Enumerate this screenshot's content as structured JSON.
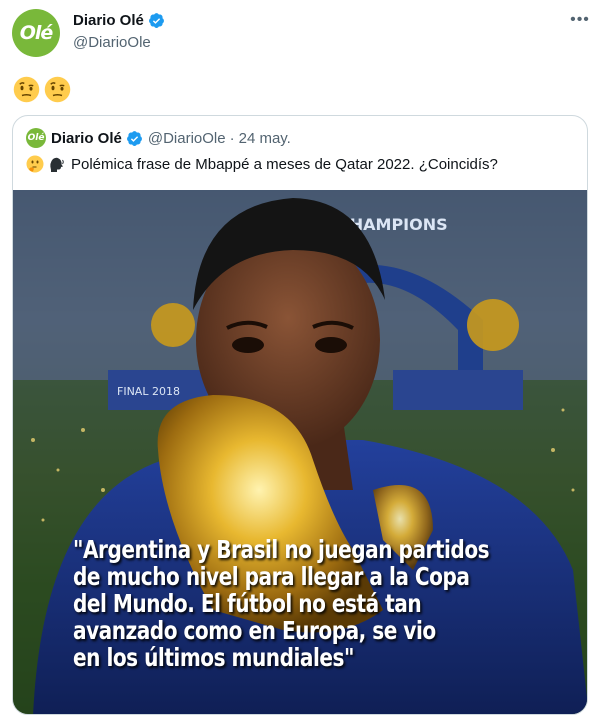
{
  "tweet": {
    "avatar_text": "Olé",
    "display_name": "Diario Olé",
    "handle": "@DiarioOle",
    "more_label": "•••",
    "emojis": [
      "face-with-raised-eyebrow-emoji",
      "face-with-raised-eyebrow-emoji"
    ]
  },
  "quoted": {
    "avatar_text": "Olé",
    "display_name": "Diario Olé",
    "handle": "@DiarioOle",
    "separator": "·",
    "date": "24 may.",
    "text": "Polémica frase de Mbappé a meses de Qatar 2022. ¿Coincidís?",
    "text_emojis": [
      "thinking-face-emoji",
      "speaking-head-emoji"
    ],
    "media": {
      "description_icon": "player-kissing-trophy-photo",
      "banner_text": "CHAMPIONS",
      "board_text": "FINAL 2018",
      "caption_lines": [
        "\"Argentina y Brasil no juegan partidos",
        "de mucho nivel para llegar a la Copa",
        "del Mundo. El fútbol no está tan",
        "avanzado como en Europa, se vio",
        "en los últimos mundiales\""
      ]
    }
  },
  "colors": {
    "brand_green": "#79b83a",
    "verified_blue": "#1d9bf0",
    "muted_text": "#536471",
    "border": "#cfd9de"
  }
}
